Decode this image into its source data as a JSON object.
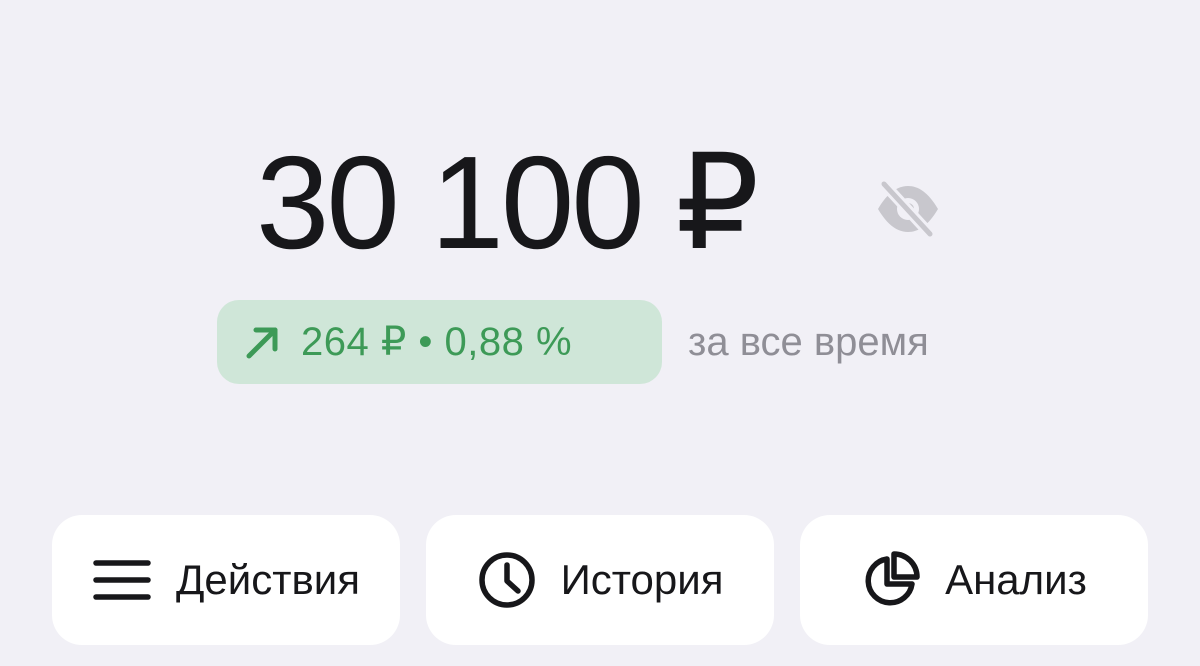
{
  "balance": {
    "amount": "30 100 ₽",
    "hide_icon": "eye-slash-icon"
  },
  "change": {
    "icon": "arrow-up-right-icon",
    "text": "264 ₽ • 0,88 %",
    "color": "#3d9a57",
    "badge_color": "#cfe6d8",
    "period": "за все время"
  },
  "actions": [
    {
      "icon": "menu-icon",
      "label": "Действия"
    },
    {
      "icon": "clock-icon",
      "label": "История"
    },
    {
      "icon": "pie-chart-icon",
      "label": "Анализ"
    }
  ],
  "colors": {
    "background": "#f1f0f6",
    "text": "#17171a",
    "muted": "#8f8e96"
  }
}
